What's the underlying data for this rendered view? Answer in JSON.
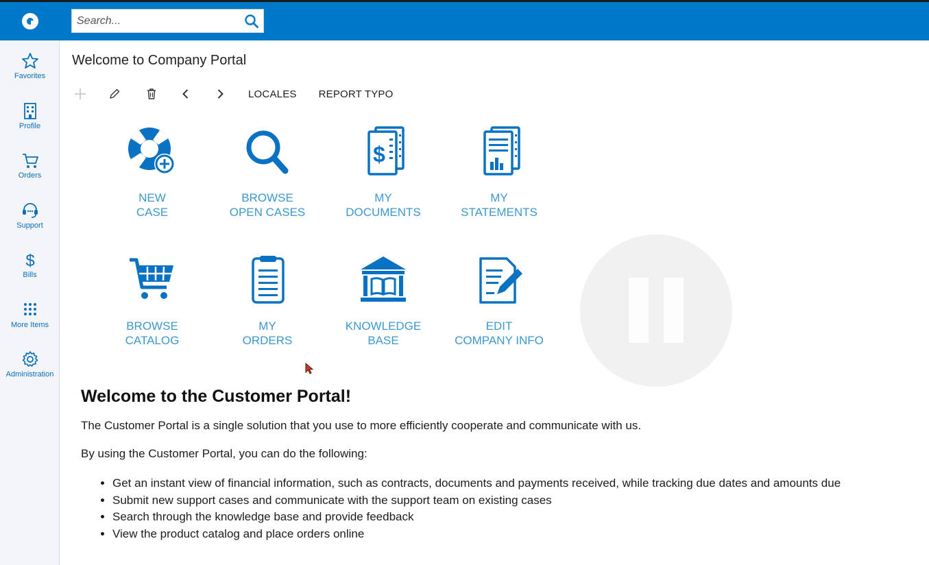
{
  "header": {
    "logo_icon": "acumatica-logo-icon",
    "search": {
      "placeholder": "Search...",
      "value": ""
    },
    "accent_color": "#0078c9"
  },
  "sidebar": {
    "items": [
      {
        "label": "Favorites",
        "icon": "star-icon"
      },
      {
        "label": "Profile",
        "icon": "building-icon"
      },
      {
        "label": "Orders",
        "icon": "cart-icon"
      },
      {
        "label": "Support",
        "icon": "headset-icon"
      },
      {
        "label": "Bills",
        "icon": "dollar-icon"
      },
      {
        "label": "More Items",
        "icon": "grid-dots-icon"
      },
      {
        "label": "Administration",
        "icon": "gear-icon"
      }
    ]
  },
  "page": {
    "title": "Welcome to Company Portal"
  },
  "toolbar": {
    "add_icon": "plus-icon",
    "edit_icon": "pencil-icon",
    "delete_icon": "trash-icon",
    "prev_icon": "chevron-left-icon",
    "next_icon": "chevron-right-icon",
    "locales_label": "LOCALES",
    "report_typo_label": "REPORT TYPO"
  },
  "tiles": [
    {
      "line1": "NEW",
      "line2": "CASE",
      "icon": "lifebuoy-plus-icon"
    },
    {
      "line1": "BROWSE",
      "line2": "OPEN CASES",
      "icon": "magnifier-icon"
    },
    {
      "line1": "MY",
      "line2": "DOCUMENTS",
      "icon": "dollar-documents-icon"
    },
    {
      "line1": "MY",
      "line2": "STATEMENTS",
      "icon": "chart-documents-icon"
    },
    {
      "line1": "BROWSE",
      "line2": "CATALOG",
      "icon": "shopping-cart-icon"
    },
    {
      "line1": "MY",
      "line2": "ORDERS",
      "icon": "clipboard-icon"
    },
    {
      "line1": "KNOWLEDGE",
      "line2": "BASE",
      "icon": "library-icon"
    },
    {
      "line1": "EDIT",
      "line2": "COMPANY INFO",
      "icon": "edit-document-icon"
    }
  ],
  "overlay": {
    "icon": "pause-icon"
  },
  "welcome": {
    "heading": "Welcome to the Customer Portal!",
    "intro": "The Customer Portal is a single solution that you use to more efficiently cooperate and communicate with us.",
    "lead": "By using the Customer Portal, you can do the following:",
    "bullets": [
      "Get an instant view of financial information, such as contracts, documents and payments received, while tracking due dates and amounts due",
      "Submit new support cases and communicate with the support team on existing cases",
      "Search through the knowledge base and provide feedback",
      "View the product catalog and place orders online"
    ]
  }
}
